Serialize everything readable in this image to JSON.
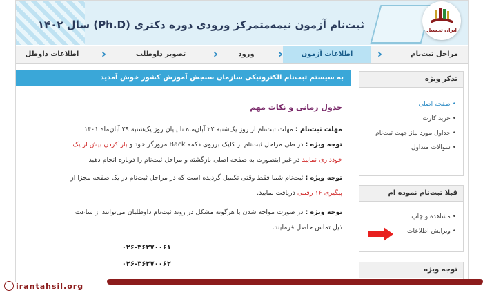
{
  "banner": {
    "title": "ثبت‌نام آزمون نیمه‌متمرکز ورودی دوره دکتری (Ph.D) سال ۱۴۰۲"
  },
  "nav": {
    "items": [
      "مراحل ثبت‌نام",
      "اطلاعات آزمون",
      "ورود",
      "تصویر داوطلب",
      "اطلاعات داوطل"
    ]
  },
  "welcome": "به سیستم ثبت‌نام الکترونیکی سازمان سنجش آموزش کشور خوش آمدید",
  "content": {
    "section_title": "جدول زمانی و نکات مهم",
    "deadline_label": "مهلت ثبت‌نام :",
    "deadline_text": "مهلت ثبت‌نام از روز یک‌شنبه ۲۲ آبان‌ماه تا پایان روز یک‌شنبه ۲۹ آبان‌ماه ۱۴۰۱",
    "note1_label": "توجه ویژه :",
    "note1_text": "در طی مراحل ثبت‌نام از کلیک برروی دکمه Back مرورگر خود و",
    "note1_red": "باز کردن بیش از یک",
    "note1_cont_red": "خودداری نمایید",
    "note1_cont": "در غیر اینصورت به صفحه اصلی بازگشته و مراحل ثبت‌نام را دوباره انجام دهید",
    "note2_label": "توجه ویژه :",
    "note2_text": "ثبت‌نام شما فقط وقتی تکمیل گردیده است که در مراحل ثبت‌نام در یک صفحه مجزا از",
    "note2_red": "پیگیری ۱۶ رقمی",
    "note2_cont": "دریافت نمایید.",
    "note3_label": "توجه ویژه :",
    "note3_text": "در صورت مواجه شدن با هرگونه مشکل در روند ثبت‌نام داوطلبان می‌توانند از ساعت",
    "note3_cont": "ذیل تماس حاصل فرمایند.",
    "phones": [
      "۰۲۶-۳۶۲۷۰۰۶۱",
      "۰۲۶-۳۶۲۷۰۰۶۲"
    ]
  },
  "sidebar": {
    "box1_title": "تذکر ویژه",
    "box1_items": [
      "صفحه اصلی",
      "خرید کارت",
      "جداول مورد نیاز جهت ثبت‌نام",
      "سوالات متداول"
    ],
    "box2_title": "قبلا ثبت‌نام نموده ام",
    "box2_items": [
      "مشاهده و چاپ",
      "ویرایش اطلاعات"
    ],
    "box3_title": "توجه ویژه"
  },
  "logo": {
    "text": "ایران تحصیل"
  },
  "footer": {
    "site": "irantahsil.org"
  },
  "colors": {
    "accent": "#3aa7d8",
    "brand": "#8c1c1c",
    "highlight_red": "#d12a2a",
    "arrow": "#e8201f"
  }
}
